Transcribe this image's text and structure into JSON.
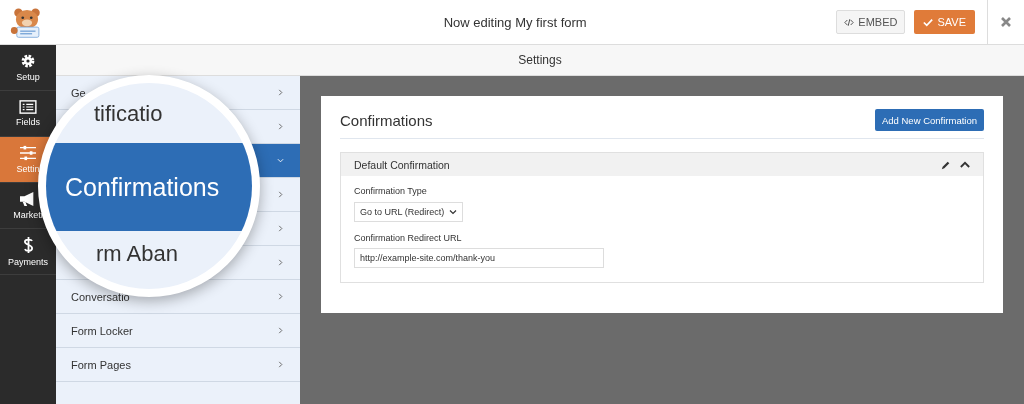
{
  "header": {
    "title": "Now editing My first form",
    "embed_button": "EMBED",
    "save_button": "SAVE"
  },
  "sidebar": {
    "items": [
      {
        "kind": "gear",
        "label": "Setup",
        "selected": false
      },
      {
        "kind": "fields",
        "label": "Fields",
        "selected": false
      },
      {
        "kind": "sliders",
        "label": "Settin",
        "selected": true
      },
      {
        "kind": "megaphone",
        "label": "Marketi",
        "selected": false
      },
      {
        "kind": "dollar",
        "label": "Payments",
        "selected": false
      }
    ]
  },
  "subheader": {
    "title": "Settings"
  },
  "panel": {
    "items": [
      {
        "label": "Ge",
        "selected": false
      },
      {
        "selected": false
      },
      {
        "selected": true
      },
      {
        "selected": false
      },
      {
        "selected": false
      },
      {
        "selected": false
      },
      {
        "label": "Conversatio",
        "selected": false
      },
      {
        "label": "Form Locker",
        "selected": false
      },
      {
        "label": "Form Pages",
        "selected": false
      }
    ]
  },
  "magnifier": {
    "top_text": "tificatio",
    "selected_text": "Confirmations",
    "bottom_text": "rm Aban"
  },
  "content": {
    "title": "Confirmations",
    "add_button": "Add New Confirmation",
    "section": {
      "title": "Default Confirmation",
      "expanded": true,
      "type_label": "Confirmation Type",
      "type_value": "Go to URL (Redirect)",
      "url_label": "Confirmation Redirect URL",
      "url_value": "http://example-site.com/thank-you"
    }
  }
}
